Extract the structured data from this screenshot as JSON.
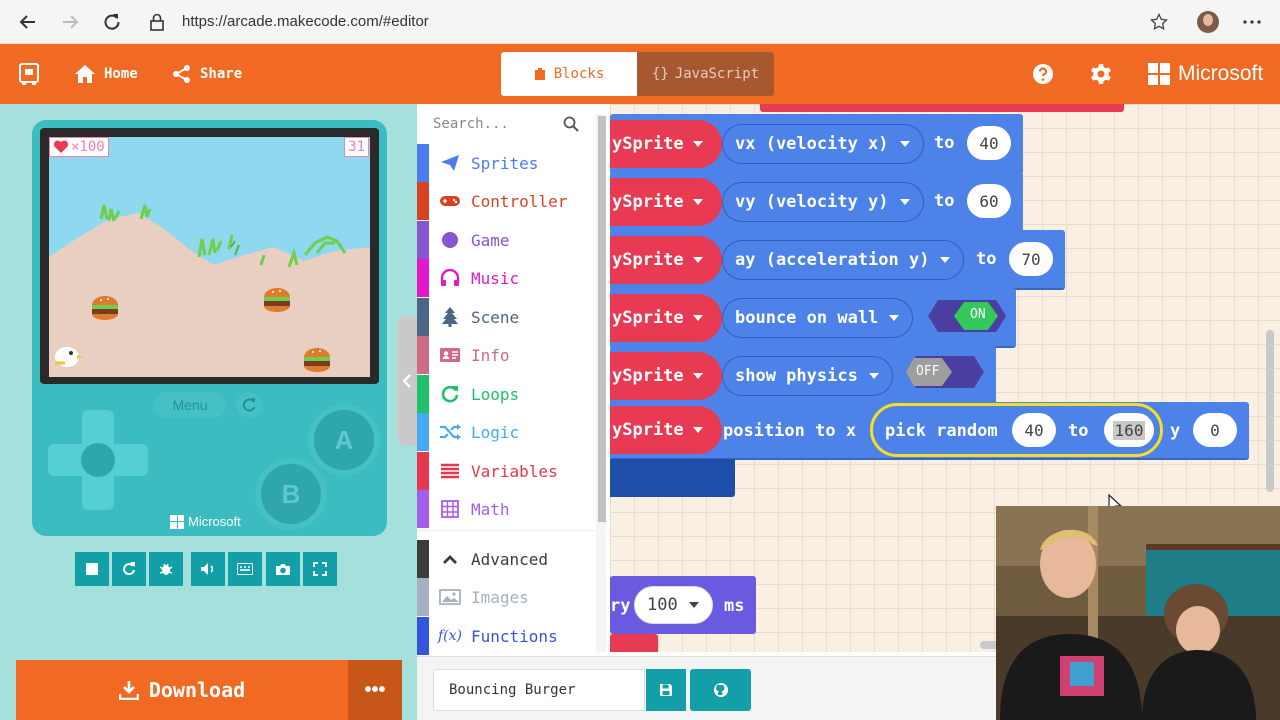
{
  "browser": {
    "url": "https://arcade.makecode.com/#editor"
  },
  "header": {
    "home_label": "Home",
    "share_label": "Share",
    "tab_blocks": "Blocks",
    "tab_javascript": "JavaScript",
    "brand": "Microsoft"
  },
  "simulator": {
    "lives_label": "×100",
    "score": "31",
    "menu_label": "Menu",
    "button_a": "A",
    "button_b": "B",
    "brand": "Microsoft",
    "download_label": "Download",
    "more_label": "•••"
  },
  "toolbox": {
    "search_placeholder": "Search...",
    "categories": [
      {
        "label": "Sprites",
        "color": "#4b7bec"
      },
      {
        "label": "Controller",
        "color": "#d54322"
      },
      {
        "label": "Game",
        "color": "#8854d0"
      },
      {
        "label": "Music",
        "color": "#e31ac8"
      },
      {
        "label": "Scene",
        "color": "#4b6584"
      },
      {
        "label": "Info",
        "color": "#cf6a87"
      },
      {
        "label": "Loops",
        "color": "#20bf6b"
      },
      {
        "label": "Logic",
        "color": "#45aaf2"
      },
      {
        "label": "Variables",
        "color": "#e5374d"
      },
      {
        "label": "Math",
        "color": "#a55eea"
      },
      {
        "label": "Advanced",
        "color": "#3c3c3c"
      },
      {
        "label": "Images",
        "color": "#a5b1c2"
      },
      {
        "label": "Functions",
        "color": "#3455db"
      }
    ]
  },
  "workspace": {
    "rows": [
      {
        "sprite": "ySprite",
        "property": "vx (velocity x)",
        "to": "to",
        "value": "40"
      },
      {
        "sprite": "ySprite",
        "property": "vy (velocity y)",
        "to": "to",
        "value": "60"
      },
      {
        "sprite": "ySprite",
        "property": "ay (acceleration y)",
        "to": "to",
        "value": "70"
      },
      {
        "sprite": "ySprite",
        "property": "bounce on wall",
        "toggle": "ON"
      },
      {
        "sprite": "ySprite",
        "property": "show physics",
        "toggle": "OFF"
      }
    ],
    "position_row": {
      "sprite": "ySprite",
      "label": "position to x",
      "random_label": "pick random",
      "from": "40",
      "to_label": "to",
      "to": "160",
      "y_label": "y",
      "y": "0"
    },
    "pause_block": {
      "prefix": "ry",
      "value": "100",
      "unit": "ms"
    }
  },
  "bottom": {
    "project_name": "Bouncing Burger"
  },
  "colors": {
    "brand_orange": "#f06a23",
    "sprite_red": "#e83a52",
    "sprite_blue": "#4d82e8",
    "teal": "#139fa7",
    "highlight": "#f3e023"
  }
}
